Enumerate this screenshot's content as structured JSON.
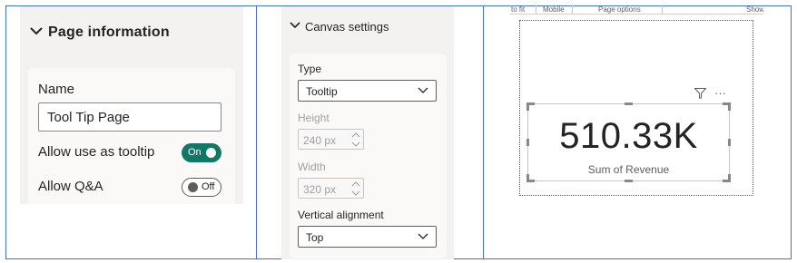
{
  "page_information": {
    "title": "Page information",
    "name_label": "Name",
    "name_value": "Tool Tip Page",
    "tooltip_label": "Allow use as tooltip",
    "tooltip_toggle": "On",
    "qa_label": "Allow Q&A",
    "qa_toggle": "Off"
  },
  "canvas_settings": {
    "title": "Canvas settings",
    "type_label": "Type",
    "type_value": "Tooltip",
    "height_label": "Height",
    "height_value": "240 px",
    "width_label": "Width",
    "width_value": "320 px",
    "valign_label": "Vertical alignment",
    "valign_value": "Top"
  },
  "report_canvas": {
    "tabs": [
      "to fit",
      "Mobile",
      "Page options",
      "Show"
    ],
    "card_value": "510.33K",
    "card_caption": "Sum of Revenue"
  },
  "colors": {
    "toggle_on": "#117865",
    "frame_border": "#4472c4",
    "pane_bg": "#f3f2f1"
  }
}
